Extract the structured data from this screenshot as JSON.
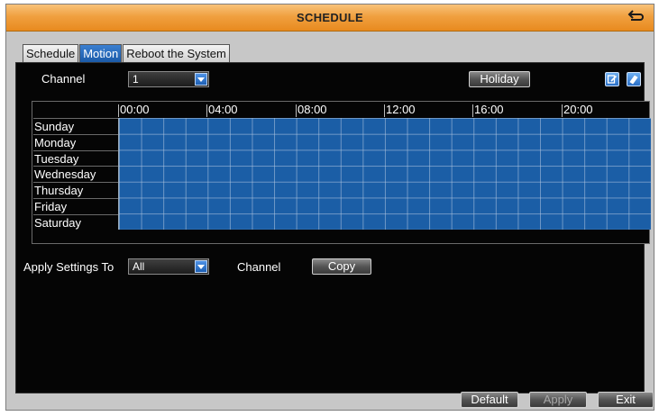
{
  "window": {
    "title": "SCHEDULE"
  },
  "tabs": [
    {
      "label": "Schedule",
      "active": false
    },
    {
      "label": "Motion",
      "active": true
    },
    {
      "label": "Reboot the System",
      "active": false
    }
  ],
  "channel": {
    "label": "Channel",
    "value": "1"
  },
  "holiday_label": "Holiday",
  "icons": {
    "back": "back-arrow-icon",
    "edit": "edit-icon",
    "erase": "eraser-icon"
  },
  "grid": {
    "hours": [
      "00:00",
      "04:00",
      "08:00",
      "12:00",
      "16:00",
      "20:00"
    ],
    "days": [
      "Sunday",
      "Monday",
      "Tuesday",
      "Wednesday",
      "Thursday",
      "Friday",
      "Saturday"
    ],
    "schedule_color": "#1b5ea6"
  },
  "apply_settings": {
    "label": "Apply Settings To",
    "value": "All",
    "channel_label": "Channel",
    "copy_label": "Copy"
  },
  "footer": {
    "default_label": "Default",
    "apply_label": "Apply",
    "exit_label": "Exit"
  },
  "colors": {
    "title_bar": "#f0a040",
    "active_tab": "#1b5aa8",
    "panel": "#050505"
  }
}
